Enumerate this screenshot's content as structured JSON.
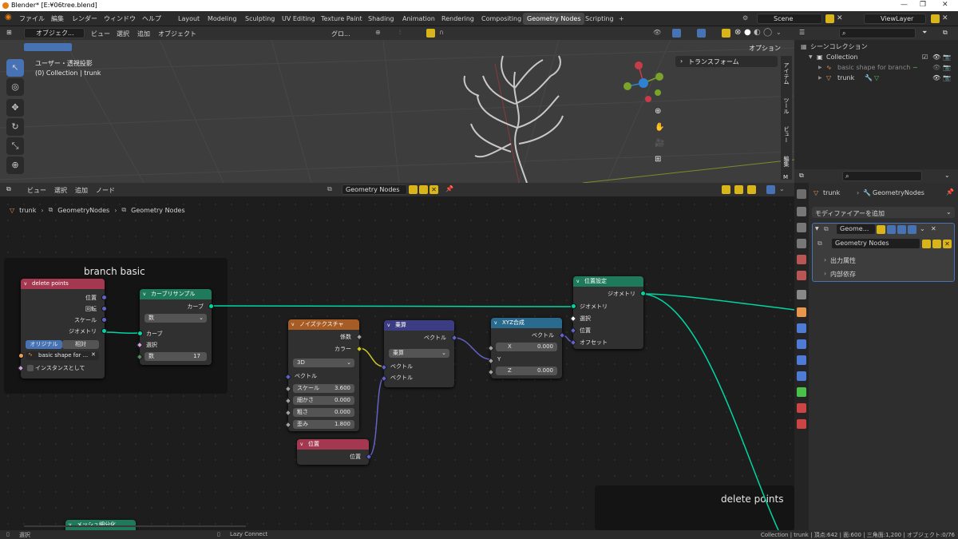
{
  "window": {
    "title": "Blender* [E:¥06tree.blend]",
    "controls": [
      "—",
      "❐",
      "✕"
    ]
  },
  "menu": [
    "ファイル",
    "編集",
    "レンダー",
    "ウィンドウ",
    "ヘルプ"
  ],
  "workspaces": [
    "Layout",
    "Modeling",
    "Sculpting",
    "UV Editing",
    "Texture Paint",
    "Shading",
    "Animation",
    "Rendering",
    "Compositing",
    "Geometry Nodes",
    "Scripting",
    "+"
  ],
  "active_workspace": "Geometry Nodes",
  "scene": "Scene",
  "view_layer": "ViewLayer",
  "viewport": {
    "mode": "オブジェク...",
    "menus": [
      "ビュー",
      "選択",
      "追加",
      "オブジェクト"
    ],
    "transform_orientation": "グロ...",
    "view_name": "ユーザー・透視投影",
    "collection_info": "(0) Collection | trunk",
    "options": "オプション",
    "sidebar_tab": "トランスフォーム",
    "side_tabs": [
      "アイテム",
      "ツール",
      "ビュー",
      "編集",
      "M"
    ]
  },
  "outliner": {
    "title": "シーンコレクション",
    "items": [
      {
        "label": "Collection",
        "level": 1
      },
      {
        "label": "basic shape for branch",
        "level": 2
      },
      {
        "label": "trunk",
        "level": 2
      }
    ]
  },
  "properties": {
    "object": "trunk",
    "modifier_name_path": "GeometryNodes",
    "add_modifier": "モディファイアーを追加",
    "modifier_short": "Geome...",
    "node_group": "Geometry Nodes",
    "panels": [
      "出力属性",
      "内部依存"
    ]
  },
  "node_editor": {
    "menus": [
      "ビュー",
      "選択",
      "追加",
      "ノード"
    ],
    "node_group": "Geometry Nodes",
    "breadcrumb": [
      "trunk",
      "GeometryNodes",
      "Geometry Nodes"
    ],
    "frames": [
      "branch basic",
      "delete points"
    ],
    "nodes": {
      "delete_points": {
        "title": "delete points",
        "outputs": [
          "位置",
          "回転",
          "スケール",
          "ジオメトリ"
        ],
        "toggle": [
          "オリジナル",
          "相対"
        ],
        "object": "basic shape for ...",
        "instance_label": "インスタンスとして"
      },
      "curve_sample": {
        "title": "カーブリサンプル",
        "out": "カーブ",
        "mode": "数",
        "in_curve": "カーブ",
        "in_select": "選択",
        "count_label": "数",
        "count_value": "17"
      },
      "noise": {
        "title": "ノイズテクスチャ",
        "out1": "係数",
        "out2": "カラー",
        "dim": "3D",
        "vector": "ベクトル",
        "fields": [
          {
            "label": "スケール",
            "value": "3.600"
          },
          {
            "label": "細かさ",
            "value": "0.000"
          },
          {
            "label": "粗さ",
            "value": "0.000"
          },
          {
            "label": "歪み",
            "value": "1.800"
          }
        ]
      },
      "multiply": {
        "title": "乗算",
        "out": "ベクトル",
        "op": "乗算",
        "in1": "ベクトル",
        "in2": "ベクトル"
      },
      "combine": {
        "title": "XYZ合成",
        "out": "ベクトル",
        "x_label": "X",
        "x_value": "0.000",
        "y_label": "Y",
        "z_label": "Z",
        "z_value": "0.000"
      },
      "set_position": {
        "title": "位置設定",
        "out": "ジオメトリ",
        "inputs": [
          "ジオメトリ",
          "選択",
          "位置",
          "オフセット"
        ]
      },
      "position": {
        "title": "位置",
        "out": "位置"
      },
      "subdivide": {
        "title": "メッシュ細分化"
      }
    }
  },
  "statusbar": {
    "left": "選択",
    "middle": "Lazy Connect",
    "right": "Collection | trunk | 頂点:642 | 面:600 | 三角面:1,200 | オブジェクト:0/76"
  }
}
